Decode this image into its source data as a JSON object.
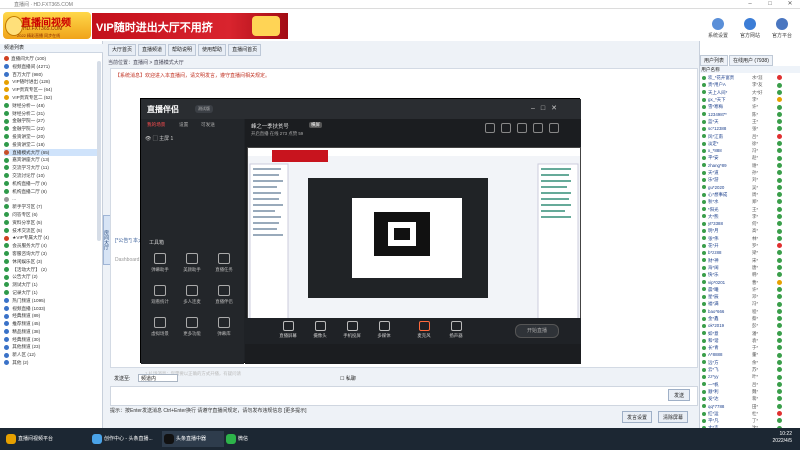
{
  "window": {
    "title": "直播间 · HD.FXT365.COM"
  },
  "banner": {
    "logo_main": "直播间视频",
    "logo_url": "HD.FXT365.COM",
    "logo_tagline": "2022 精彩直播 同步在线",
    "vip_text": "VIP随时进出大厅不用挤",
    "top_icons": [
      {
        "label": "系统设置",
        "icon": "gear-icon",
        "color": "#5a8fd8"
      },
      {
        "label": "官方网站",
        "icon": "home-icon",
        "color": "#3c7dd6"
      },
      {
        "label": "官方平台",
        "icon": "platform-icon",
        "color": "#4a76c0"
      }
    ]
  },
  "left_panel": {
    "header": "频道列表",
    "side_tab": "房间大厅",
    "tree": [
      {
        "text": "直播间大厅 (100)",
        "color": "#d04020",
        "selected": false
      },
      {
        "text": "  视频直播间 (4271)",
        "color": "#3a72c8",
        "selected": false
      },
      {
        "text": "  百万大厅 (980)",
        "color": "#3a72c8",
        "selected": false
      },
      {
        "text": "    VIP随时进出 (128)",
        "color": "#e6a000",
        "selected": false
      },
      {
        "text": "    VIP贵宾专区一 (64)",
        "color": "#e6a000",
        "selected": false
      },
      {
        "text": "    VIP贵宾专区二 (52)",
        "color": "#e6a000",
        "selected": false
      },
      {
        "text": "    财经分析一 (48)",
        "color": "#2f9a4a",
        "selected": false
      },
      {
        "text": "    财经分析二 (31)",
        "color": "#2f9a4a",
        "selected": false
      },
      {
        "text": "    金融学院一 (27)",
        "color": "#2f9a4a",
        "selected": false
      },
      {
        "text": "    金融学院二 (22)",
        "color": "#2f9a4a",
        "selected": false
      },
      {
        "text": "    投资讲堂一 (20)",
        "color": "#2f9a4a",
        "selected": false
      },
      {
        "text": "    投资讲堂二 (18)",
        "color": "#2f9a4a",
        "selected": false
      },
      {
        "text": "    直播模式大厅 (65)",
        "color": "#c8502a",
        "selected": true
      },
      {
        "text": "    嘉宾讲座大厅 (13)",
        "color": "#2f9a4a",
        "selected": false
      },
      {
        "text": "    交流学习大厅 (11)",
        "color": "#2f9a4a",
        "selected": false
      },
      {
        "text": "    交流讨论厅 (10)",
        "color": "#2f9a4a",
        "selected": false
      },
      {
        "text": "    机构直播一厅 (9)",
        "color": "#2f9a4a",
        "selected": false
      },
      {
        "text": "    机构直播二厅 (8)",
        "color": "#2f9a4a",
        "selected": false
      },
      {
        "text": "    ...",
        "color": "#999999",
        "selected": false
      },
      {
        "text": "    新手学习区 (7)",
        "color": "#2f9a4a",
        "selected": false
      },
      {
        "text": "    问答专区 (6)",
        "color": "#2f9a4a",
        "selected": false
      },
      {
        "text": "    资料分享区 (5)",
        "color": "#2f9a4a",
        "selected": false
      },
      {
        "text": "    技术交流区 (5)",
        "color": "#2f9a4a",
        "selected": false
      },
      {
        "text": "    ★VIP专属大厅 (4)",
        "color": "#d04020",
        "selected": false
      },
      {
        "text": "    会员服务大厅 (4)",
        "color": "#2f9a4a",
        "selected": false
      },
      {
        "text": "    客服咨询大厅 (3)",
        "color": "#2f9a4a",
        "selected": false
      },
      {
        "text": "    休闲娱乐区 (3)",
        "color": "#2f9a4a",
        "selected": false
      },
      {
        "text": "    【活动大厅】 (2)",
        "color": "#2f9a4a",
        "selected": false
      },
      {
        "text": "    公告大厅 (2)",
        "color": "#2f9a4a",
        "selected": false
      },
      {
        "text": "    测试大厅 (1)",
        "color": "#2f9a4a",
        "selected": false
      },
      {
        "text": "    记录大厅 (1)",
        "color": "#2f9a4a",
        "selected": false
      },
      {
        "text": "  热门频道 (1095)",
        "color": "#3a72c8",
        "selected": false
      },
      {
        "text": "  视频直播 (1033)",
        "color": "#3a72c8",
        "selected": false
      },
      {
        "text": "  经典频道 (89)",
        "color": "#3a72c8",
        "selected": false
      },
      {
        "text": "  推荐频道 (45)",
        "color": "#3a72c8",
        "selected": false
      },
      {
        "text": "  精品频道 (38)",
        "color": "#3a72c8",
        "selected": false
      },
      {
        "text": "  经典频道 (30)",
        "color": "#3a72c8",
        "selected": false
      },
      {
        "text": "  其他频道 (23)",
        "color": "#3a72c8",
        "selected": false
      },
      {
        "text": "  新人区 (12)",
        "color": "#3a72c8",
        "selected": false
      },
      {
        "text": "  其他 (2)",
        "color": "#3a72c8",
        "selected": false
      }
    ]
  },
  "center": {
    "tabs": [
      "大厅首页",
      "直播频道",
      "帮助说明",
      "使用帮助",
      "直播间首页"
    ],
    "breadcrumb": "当前位置：直播间 > 直播模式大厅",
    "messages": [
      "【系统消息】欢迎进入本直播间，请文明发言，遵守直播间相关规定。",
      "[*公告*] 本大厅已开启直播模式，请勿刷屏。",
      "Dashboard"
    ]
  },
  "recorder": {
    "app_name": "直播伴侣",
    "badge": "测试版",
    "side_tabs": [
      "我的场景",
      "设置",
      "可发送"
    ],
    "scene_name": "主屏 1",
    "tools_title": "工具箱",
    "tools": [
      "弹幕助手",
      "美颜助手",
      "直播任务",
      "观看统计",
      "多人连麦",
      "直播伴侣",
      "虚拟场景",
      "更多功能",
      "弹幕库"
    ],
    "title": "峰之一季扶贫号",
    "tag": "横屏",
    "subtitle": "开启直播  在线 273  点赞 59",
    "controls": [
      "直播屏幕",
      "摄像头",
      "手机投屏",
      "多媒体",
      "麦克风",
      "扬声器"
    ],
    "start_label": "开始直播",
    "notice": "1 扎场消息：您需要以正确的方式开播，有疑问请联系客服"
  },
  "input": {
    "label": "发送至:",
    "target": "频道内",
    "checkbox": "私聊",
    "send_label": "发送"
  },
  "notebar": "提示：按Enter发送消息  Ctrl+Enter换行  请遵守直播间规定，请勿发布违规信息  [更多提示]",
  "bottom_buttons": [
    "发言设置",
    "清除屏幕"
  ],
  "right_panel": {
    "tabs": [
      "用户列表",
      "在线用户 (7938)"
    ],
    "header": "用户名称",
    "users": [
      [
        "欢_*花开富贵",
        "水*涯",
        "#e03030"
      ],
      [
        "贵*用户A",
        "李*友",
        "#3a9e4a"
      ],
      [
        "天上人间*",
        "大*好",
        "#3a9e4a"
      ],
      [
        "gx_*天下",
        "李*",
        "#e6a000"
      ],
      [
        "雪*寒梅",
        "许*",
        "#3a9e4a"
      ],
      [
        "1234987*",
        "陈*",
        "#3a9e4a"
      ],
      [
        "蓝*天",
        "王*",
        "#3a9e4a"
      ],
      [
        "sc*12388",
        "张*",
        "#3a9e4a"
      ],
      [
        "风*江南",
        "吕*",
        "#e03030"
      ],
      [
        "淡定*",
        "徐*",
        "#3a9e4a"
      ],
      [
        "x_*888",
        "冯*",
        "#3a9e4a"
      ],
      [
        "平*安",
        "赵*",
        "#3a9e4a"
      ],
      [
        "zhang*89",
        "谢*",
        "#3a9e4a"
      ],
      [
        "天*道",
        "孙*",
        "#3a9e4a"
      ],
      [
        "乐*游",
        "刘*",
        "#3a9e4a"
      ],
      [
        "gu*2020",
        "吴*",
        "#3a9e4a"
      ],
      [
        "心*想事成",
        "周*",
        "#3a9e4a"
      ],
      [
        "秋*水",
        "郑*",
        "#3a9e4a"
      ],
      [
        "*阳光",
        "王*",
        "#3a9e4a"
      ],
      [
        "大*熊",
        "李*",
        "#3a9e4a"
      ],
      [
        "yt*3388",
        "何*",
        "#3a9e4a"
      ],
      [
        "明*月",
        "高*",
        "#3a9e4a"
      ],
      [
        "张*伟",
        "林*",
        "#3a9e4a"
      ],
      [
        "花*开",
        "罗*",
        "#e03030"
      ],
      [
        "b*zz88",
        "梁*",
        "#3a9e4a"
      ],
      [
        "财*神",
        "宋*",
        "#3a9e4a"
      ],
      [
        "海*阔",
        "唐*",
        "#3a9e4a"
      ],
      [
        "快*乐",
        "韩*",
        "#3a9e4a"
      ],
      [
        "vip*0201",
        "曹*",
        "#e6a000"
      ],
      [
        "晨*曦",
        "许*",
        "#3a9e4a"
      ],
      [
        "星*辰",
        "邓*",
        "#3a9e4a"
      ],
      [
        "福*满",
        "冯*",
        "#3a9e4a"
      ],
      [
        "bao*666",
        "程*",
        "#3a9e4a"
      ],
      [
        "金*鑫",
        "蔡*",
        "#3a9e4a"
      ],
      [
        "ok*2019",
        "彭*",
        "#3a9e4a"
      ],
      [
        "如*意",
        "潘*",
        "#3a9e4a"
      ],
      [
        "和*谐",
        "袁*",
        "#3a9e4a"
      ],
      [
        "长*青",
        "于*",
        "#3a9e4a"
      ],
      [
        "A*8888",
        "董*",
        "#3a9e4a"
      ],
      [
        "远*方",
        "余*",
        "#3a9e4a"
      ],
      [
        "云*飞",
        "苏*",
        "#3a9e4a"
      ],
      [
        "zz*yy",
        "叶*",
        "#3a9e4a"
      ],
      [
        "一*帆",
        "吕*",
        "#3a9e4a"
      ],
      [
        "顺*利",
        "魏*",
        "#3a9e4a"
      ],
      [
        "发*达",
        "蒋*",
        "#3a9e4a"
      ],
      [
        "qq*7788",
        "田*",
        "#3a9e4a"
      ],
      [
        "红*运",
        "杜*",
        "#e03030"
      ],
      [
        "平*凡",
        "丁*",
        "#3a9e4a"
      ],
      [
        "大*吉",
        "沈*",
        "#3a9e4a"
      ]
    ]
  },
  "taskbar": {
    "items": [
      {
        "label": "直播间视频平台",
        "color": "#e6a000"
      },
      {
        "label": "创作中心 - 头条直播...",
        "color": "#4aa3e8"
      },
      {
        "label": "头条直播中器",
        "color": "#111111"
      },
      {
        "label": "微信",
        "color": "#2db34a"
      }
    ],
    "time": "10:22",
    "date": "2022/4/5"
  }
}
